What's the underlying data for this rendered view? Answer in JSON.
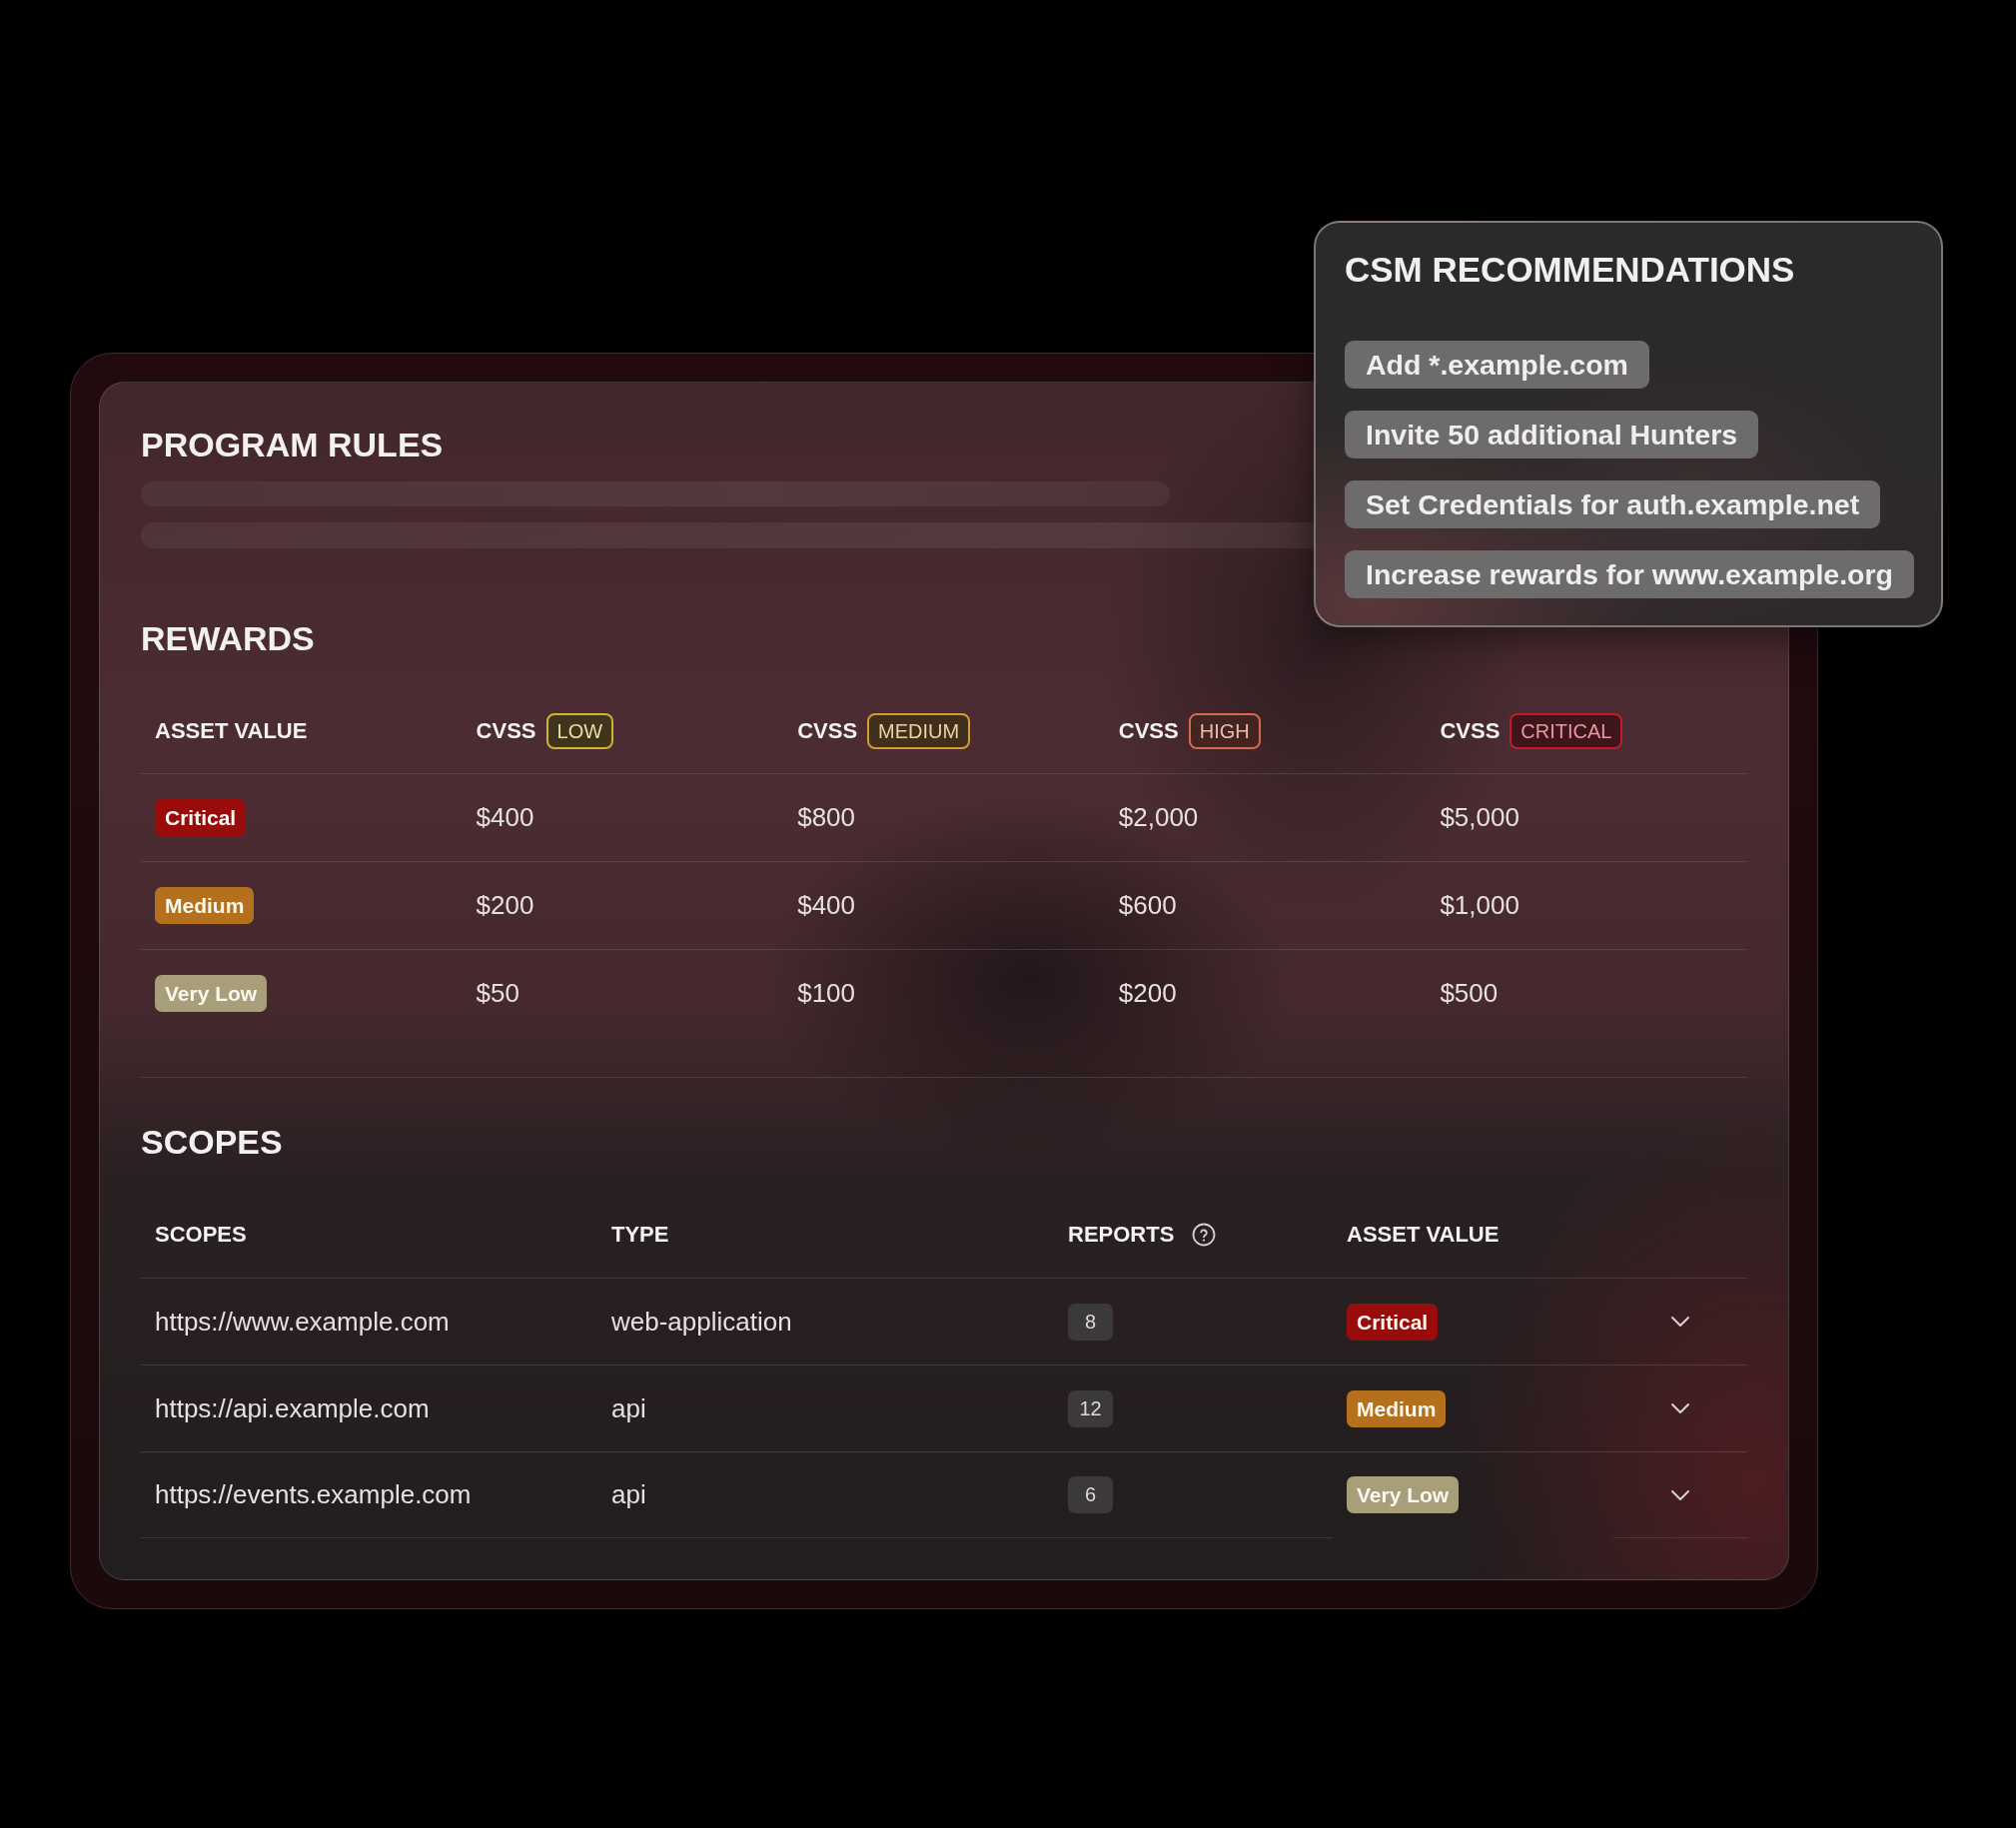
{
  "program_rules": {
    "title": "PROGRAM RULES"
  },
  "rewards": {
    "title": "REWARDS",
    "columns": [
      {
        "label": "ASSET VALUE"
      },
      {
        "label": "CVSS",
        "tag": {
          "text": "LOW",
          "color": "#cdb433"
        }
      },
      {
        "label": "CVSS",
        "tag": {
          "text": "MEDIUM",
          "color": "#d39b34"
        }
      },
      {
        "label": "CVSS",
        "tag": {
          "text": "HIGH",
          "color": "#d8694a"
        }
      },
      {
        "label": "CVSS",
        "tag": {
          "text": "CRITICAL",
          "color": "#c8192a"
        }
      }
    ],
    "rows": [
      {
        "asset_value": {
          "text": "Critical",
          "color": "#9a0b0b"
        },
        "values": [
          "$400",
          "$800",
          "$2,000",
          "$5,000"
        ]
      },
      {
        "asset_value": {
          "text": "Medium",
          "color": "#b4701d"
        },
        "values": [
          "$200",
          "$400",
          "$600",
          "$1,000"
        ]
      },
      {
        "asset_value": {
          "text": "Very Low",
          "color": "#a89e79"
        },
        "values": [
          "$50",
          "$100",
          "$200",
          "$500"
        ]
      }
    ]
  },
  "scopes": {
    "title": "SCOPES",
    "columns": [
      {
        "label": "SCOPES",
        "help": false
      },
      {
        "label": "TYPE",
        "help": false
      },
      {
        "label": "REPORTS",
        "help": true
      },
      {
        "label": "ASSET VALUE",
        "help": false
      }
    ],
    "rows": [
      {
        "scope": "https://www.example.com",
        "type": "web-application",
        "reports": "8",
        "asset_value": {
          "text": "Critical",
          "color": "#9a0b0b"
        },
        "expanded": false
      },
      {
        "scope": "https://api.example.com",
        "type": "api",
        "reports": "12",
        "asset_value": {
          "text": "Medium",
          "color": "#b4701d"
        },
        "expanded": false
      },
      {
        "scope": "https://events.example.com",
        "type": "api",
        "reports": "6",
        "asset_value": {
          "text": "Very Low",
          "color": "#a89e79"
        },
        "expanded": false
      }
    ]
  },
  "csm_recommendations": {
    "title": "CSM RECOMMENDATIONS",
    "items": [
      "Add *.example.com",
      "Invite 50 additional Hunters",
      "Set Credentials for auth.example.net",
      "Increase rewards for www.example.org"
    ]
  }
}
